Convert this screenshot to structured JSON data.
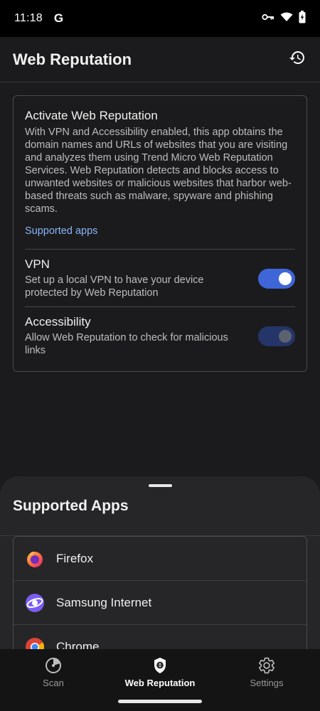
{
  "status_bar": {
    "time": "11:18",
    "google_badge": "G"
  },
  "header": {
    "title": "Web Reputation"
  },
  "card": {
    "title": "Activate Web Reputation",
    "description": "With VPN and Accessibility enabled, this app obtains the domain names and URLs of websites that you are visiting and analyzes them using Trend Micro Web Reputation Services. Web Reputation detects and blocks access to unwanted websites or malicious websites that harbor web-based threats such as malware, spyware and phishing scams.",
    "link_label": "Supported apps",
    "settings": [
      {
        "title": "VPN",
        "subtitle": "Set up a local VPN to have your device protected by Web Reputation",
        "enabled": true
      },
      {
        "title": "Accessibility",
        "subtitle": "Allow Web Reputation to check for malicious links",
        "enabled": false
      }
    ]
  },
  "sheet": {
    "title": "Supported Apps",
    "apps": [
      {
        "name": "Firefox",
        "icon": "firefox-icon"
      },
      {
        "name": "Samsung Internet",
        "icon": "samsung-internet-icon"
      },
      {
        "name": "Chrome",
        "icon": "chrome-icon"
      }
    ]
  },
  "nav": {
    "items": [
      {
        "label": "Scan",
        "icon": "scan-icon",
        "active": false
      },
      {
        "label": "Web Reputation",
        "icon": "shield-icon",
        "active": true
      },
      {
        "label": "Settings",
        "icon": "gear-icon",
        "active": false
      }
    ]
  },
  "colors": {
    "accent": "#3e66d8",
    "link": "#8ab4f8",
    "background": "#1b1b1d"
  }
}
